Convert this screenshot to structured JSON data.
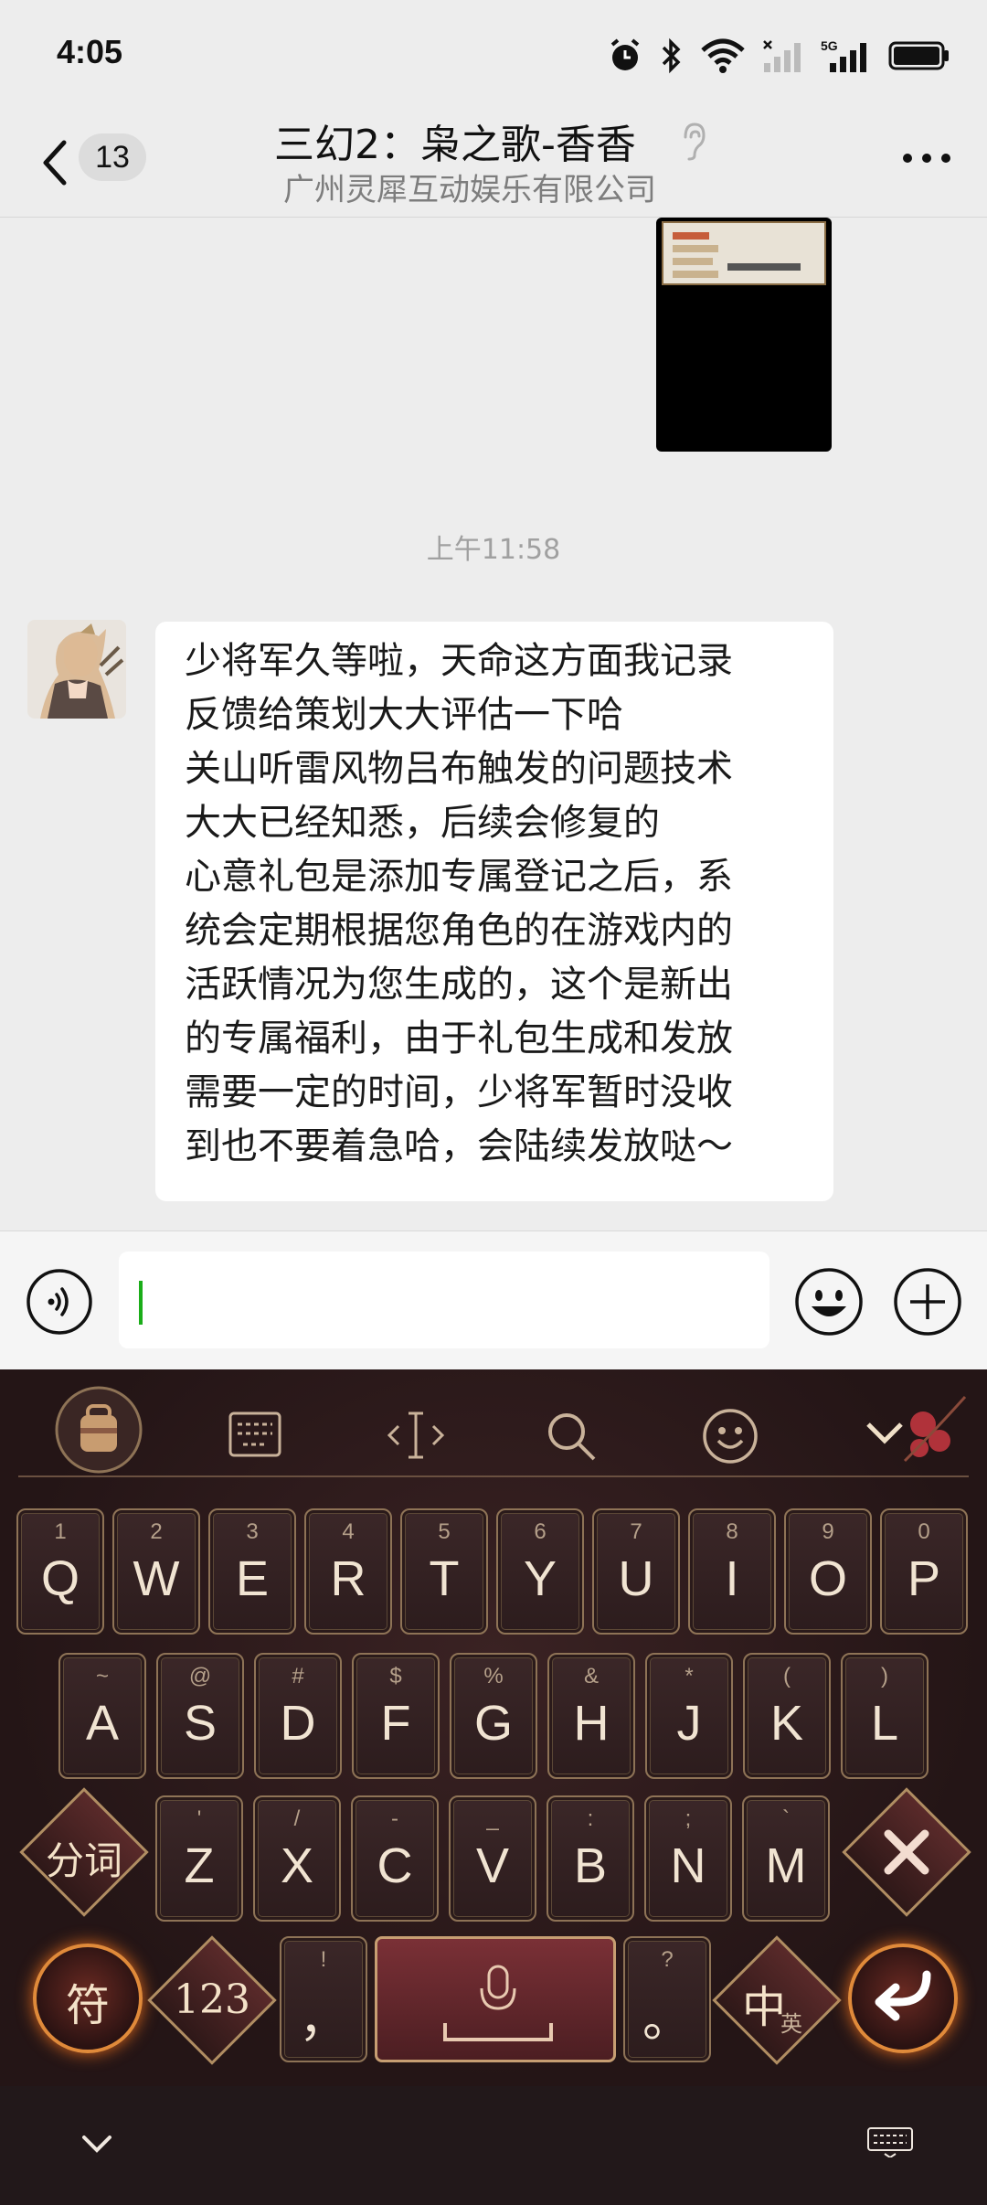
{
  "status_bar": {
    "time": "4:05",
    "icons": [
      "alarm-icon",
      "bluetooth-icon",
      "wifi-icon",
      "signal-icon",
      "5g-signal-icon",
      "battery-icon"
    ]
  },
  "header": {
    "unread_count": "13",
    "title": "三幻2：枭之歌-香香",
    "subtitle": "广州灵犀互动娱乐有限公司"
  },
  "messages": {
    "timestamp": "上午11:58",
    "bubble_lines": [
      "少将军久等啦，天命这方面我记录",
      "反馈给策划大大评估一下哈",
      "关山听雷风物吕布触发的问题技术",
      "大大已经知悉，后续会修复的",
      "心意礼包是添加专属登记之后，系",
      "统会定期根据您角色的在游戏内的",
      "活跃情况为您生成的，这个是新出",
      "的专属福利，由于礼包生成和发放",
      "需要一定的时间，少将军暂时没收",
      "到也不要着急哈，会陆续发放哒～"
    ]
  },
  "input": {
    "value": ""
  },
  "keyboard": {
    "row1": [
      {
        "hint": "1",
        "letter": "Q"
      },
      {
        "hint": "2",
        "letter": "W"
      },
      {
        "hint": "3",
        "letter": "E"
      },
      {
        "hint": "4",
        "letter": "R"
      },
      {
        "hint": "5",
        "letter": "T"
      },
      {
        "hint": "6",
        "letter": "Y"
      },
      {
        "hint": "7",
        "letter": "U"
      },
      {
        "hint": "8",
        "letter": "I"
      },
      {
        "hint": "9",
        "letter": "O"
      },
      {
        "hint": "0",
        "letter": "P"
      }
    ],
    "row2": [
      {
        "hint": "~",
        "letter": "A"
      },
      {
        "hint": "@",
        "letter": "S"
      },
      {
        "hint": "#",
        "letter": "D"
      },
      {
        "hint": "$",
        "letter": "F"
      },
      {
        "hint": "%",
        "letter": "G"
      },
      {
        "hint": "&",
        "letter": "H"
      },
      {
        "hint": "*",
        "letter": "J"
      },
      {
        "hint": "(",
        "letter": "K"
      },
      {
        "hint": ")",
        "letter": "L"
      }
    ],
    "row3": [
      {
        "hint": "'",
        "letter": "Z"
      },
      {
        "hint": "/",
        "letter": "X"
      },
      {
        "hint": "-",
        "letter": "C"
      },
      {
        "hint": "_",
        "letter": "V"
      },
      {
        "hint": ":",
        "letter": "B"
      },
      {
        "hint": ";",
        "letter": "N"
      },
      {
        "hint": "`",
        "letter": "M"
      }
    ],
    "segment_label": "分词",
    "symbol_label": "符",
    "number_label": "123",
    "comma_hint": "!",
    "comma_label": "，",
    "period_hint": "?",
    "period_label": "。",
    "lang_main": "中",
    "lang_sub": "英"
  },
  "colors": {
    "accent_green": "#1aad19",
    "bubble_bg": "#ffffff",
    "chat_bg": "#ededed",
    "key_border": "#8e7356"
  }
}
